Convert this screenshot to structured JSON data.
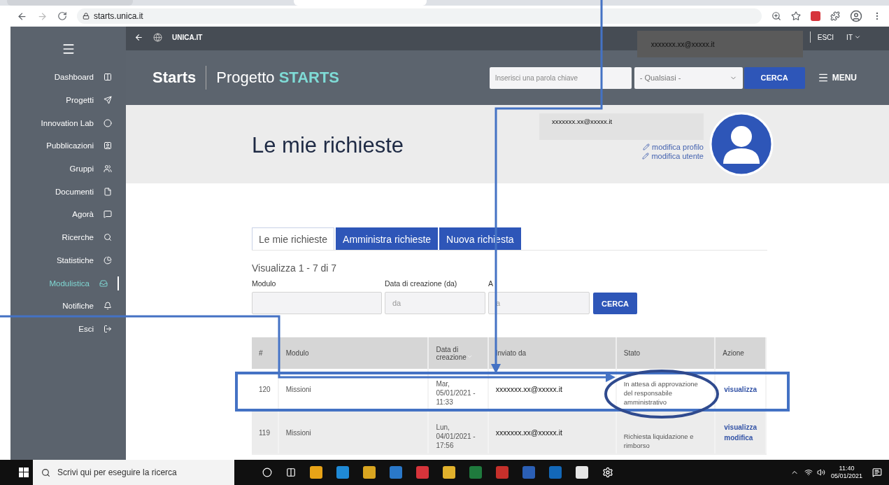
{
  "browser": {
    "url": "starts.unica.it"
  },
  "sidebar": {
    "items": [
      {
        "label": "Dashboard",
        "selected": false
      },
      {
        "label": "Progetti",
        "selected": false
      },
      {
        "label": "Innovation Lab",
        "selected": false
      },
      {
        "label": "Pubblicazioni",
        "selected": false
      },
      {
        "label": "Gruppi",
        "selected": false
      },
      {
        "label": "Documenti",
        "selected": false
      },
      {
        "label": "Agorà",
        "selected": false
      },
      {
        "label": "Ricerche",
        "selected": false
      },
      {
        "label": "Statistiche",
        "selected": false
      },
      {
        "label": "Modulistica",
        "selected": true
      },
      {
        "label": "Notifiche",
        "selected": false
      },
      {
        "label": "Esci",
        "selected": false
      }
    ]
  },
  "topbar": {
    "site": "UNICA.IT",
    "user": "xxxxxxx.xx@xxxxx.it",
    "logout": "ESCI",
    "language": "IT"
  },
  "header": {
    "brand": "Starts",
    "project_prefix": "Progetto",
    "project_name": "STARTS",
    "search": {
      "placeholder": "Inserisci una parola chiave"
    },
    "filter": {
      "value": "- Qualsiasi -"
    },
    "search_button": "CERCA",
    "menu": "MENU"
  },
  "profile": {
    "title": "Le mie richieste",
    "user": "xxxxxxx.xx@xxxxx.it",
    "links": [
      "modifica profilo",
      "modifica utente"
    ]
  },
  "tabs": [
    {
      "label": "Le mie richieste",
      "selected": true
    },
    {
      "label": "Amministra richieste",
      "selected": false
    },
    {
      "label": "Nuova richiesta",
      "selected": false
    }
  ],
  "result_count": "Visualizza 1 - 7 di 7",
  "filters": {
    "fields": [
      {
        "label": "Modulo"
      },
      {
        "label": "Data di creazione (da)",
        "placeholder": "da"
      },
      {
        "label": "A",
        "placeholder": "a"
      }
    ],
    "button": "CERCA"
  },
  "table": {
    "columns": [
      {
        "label": "#",
        "sorted": false
      },
      {
        "label": "Modulo",
        "sorted": false
      },
      {
        "label": "Data di creazione",
        "sorted": true
      },
      {
        "label": "Inviato da",
        "sorted": false
      },
      {
        "label": "Stato",
        "sorted": false
      },
      {
        "label": "Azione",
        "sorted": false
      }
    ],
    "rows": [
      {
        "id": "120",
        "module": "Missioni",
        "date": "Mar, 05/01/2021 - 11:33",
        "sender": "xxxxxxx.xx@xxxxx.it",
        "status": "In attesa di approvazione del responsabile amministrativo",
        "actions": [
          "visualizza"
        ]
      },
      {
        "id": "119",
        "module": "Missioni",
        "date": "Lun, 04/01/2021 - 17:56",
        "sender": "xxxxxxx.xx@xxxxx.it",
        "status": "Richiesta liquidazione e rimborso",
        "actions": [
          "visualizza",
          "modifica"
        ]
      }
    ]
  },
  "annotations": [
    {
      "kind": "arrow"
    },
    {
      "kind": "arrow"
    },
    {
      "kind": "rectangle"
    },
    {
      "kind": "ellipse"
    }
  ],
  "taskbar": {
    "search_placeholder": "Scrivi qui per eseguire la ricerca",
    "time": "11:40",
    "date": "05/01/2021"
  }
}
